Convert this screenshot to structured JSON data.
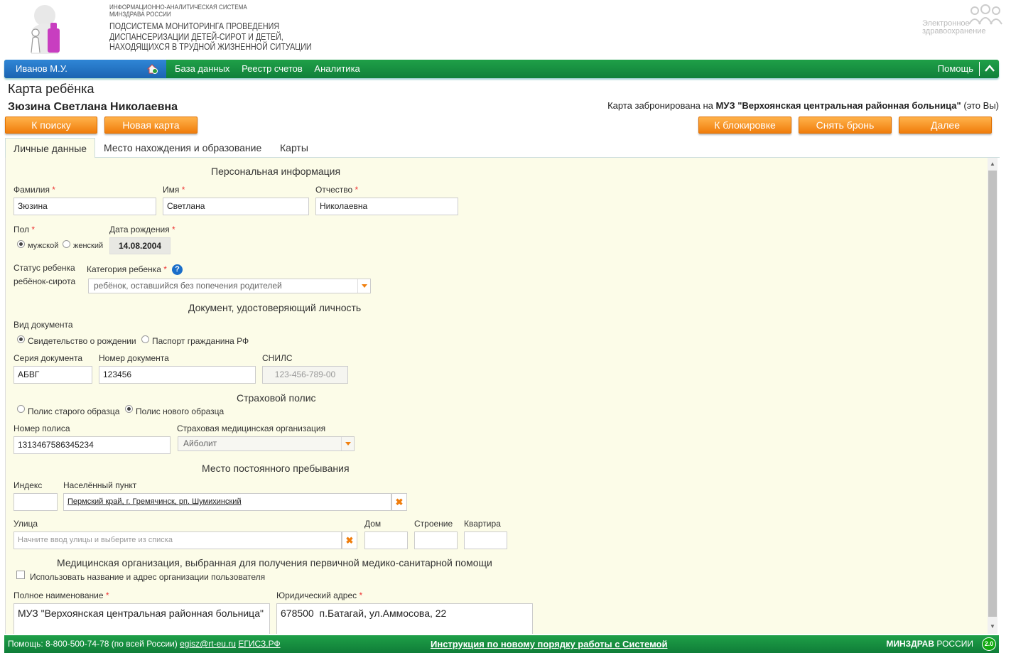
{
  "header": {
    "system_small": [
      "ИНФОРМАЦИОННО-АНАЛИТИЧЕСКАЯ СИСТЕМА",
      "МИНЗДРАВА РОССИИ"
    ],
    "system_big": [
      "ПОДСИСТЕМА МОНИТОРИНГА ПРОВЕДЕНИЯ",
      "ДИСПАНСЕРИЗАЦИИ ДЕТЕЙ-СИРОТ И ДЕТЕЙ,",
      "НАХОДЯЩИХСЯ В ТРУДНОЙ ЖИЗНЕННОЙ СИТУАЦИИ"
    ],
    "ez_logo": [
      "Электронное",
      "здравоохранение"
    ]
  },
  "nav": {
    "user": "Иванов М.У.",
    "links": [
      "База данных",
      "Реестр счетов",
      "Аналитика"
    ],
    "help": "Помощь"
  },
  "page": {
    "title": "Карта ребёнка",
    "child_name": "Зюзина Светлана Николаевна",
    "reserved_prefix": "Карта забронирована на ",
    "reserved_org": "МУЗ \"Верхоянская центральная районная больница\"",
    "reserved_suffix": " (это Вы)"
  },
  "buttons": {
    "search": "К поиску",
    "new_card": "Новая карта",
    "block": "К блокировке",
    "unreserve": "Снять бронь",
    "next": "Далее"
  },
  "tabs": [
    "Личные данные",
    "Место нахождения и образование",
    "Карты"
  ],
  "form": {
    "personal_section": "Персональная информация",
    "surname_label": "Фамилия",
    "surname": "Зюзина",
    "name_label": "Имя",
    "name": "Светлана",
    "patronymic_label": "Отчество",
    "patronymic": "Николаевна",
    "sex_label": "Пол",
    "sex_male": "мужской",
    "sex_female": "женский",
    "birth_label": "Дата рождения",
    "birth_date": "14.08.2004",
    "status_label": "Статус ребенка",
    "status_value": "ребёнок-сирота",
    "category_label": "Категория ребенка",
    "category_value": "ребёнок, оставшийся без попечения родителей",
    "doc_section": "Документ, удостоверяющий личность",
    "doc_type_label": "Вид документа",
    "doc_birth_cert": "Свидетельство о рождении",
    "doc_passport": "Паспорт гражданина РФ",
    "doc_series_label": "Серия документа",
    "doc_series": "АБВГ",
    "doc_number_label": "Номер документа",
    "doc_number": "123456",
    "snils_label": "СНИЛС",
    "snils_placeholder": "123-456-789-00",
    "policy_section": "Страховой полис",
    "policy_old": "Полис старого образца",
    "policy_new": "Полис нового образца",
    "policy_number_label": "Номер полиса",
    "policy_number": "1313467586345234",
    "insurer_label": "Страховая медицинская организация",
    "insurer_value": "Айболит",
    "residence_section": "Место постоянного пребывания",
    "index_label": "Индекс",
    "locality_label": "Населённый пункт",
    "locality_value": "Пермский край, г. Гремячинск, рп. Шумихинский",
    "street_label": "Улица",
    "street_placeholder": "Начните ввод улицы и выберите из списка",
    "house_label": "Дом",
    "building_label": "Строение",
    "apartment_label": "Квартира",
    "med_org_section": "Медицинская организация, выбранная для получения первичной медико-санитарной помощи",
    "use_user_org": "Использовать название и адрес организации пользователя",
    "full_name_label": "Полное наименование",
    "full_name_value": "МУЗ \"Верхоянская центральная районная больница\"",
    "legal_address_label": "Юридический адрес",
    "legal_address_value": "678500  п.Батагай, ул.Аммосова, 22",
    "required_mark": "*",
    "help_mark": "?",
    "clear_mark": "✖"
  },
  "footer": {
    "phone": "Помощь: 8-800-500-74-78 (по всей России)",
    "email": "egisz@rt-eu.ru",
    "egisz": "ЕГИСЗ.РФ",
    "instruction": "Инструкция по новому порядку работы с Системой",
    "ministry_bold": "МИНЗДРАВ",
    "ministry_rest": " РОССИИ",
    "version": "2.0"
  }
}
